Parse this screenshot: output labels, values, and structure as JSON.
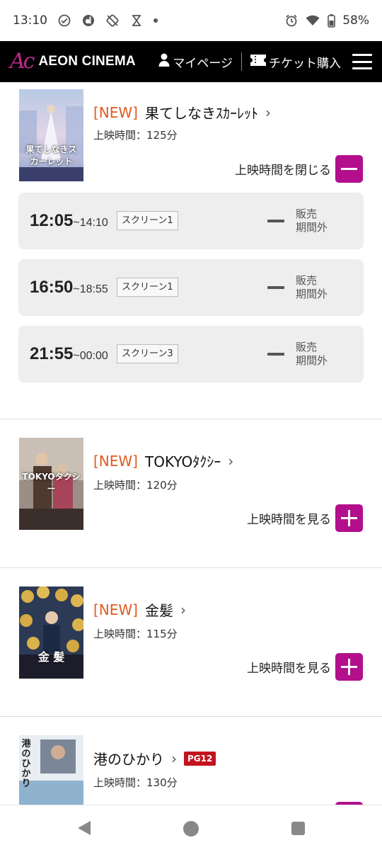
{
  "status_bar": {
    "time": "13:10",
    "left_icons": [
      "check-circle-icon",
      "d-app-icon",
      "rotate-off-icon",
      "hourglass-icon",
      "dot-icon"
    ],
    "right_icons": [
      "alarm-icon",
      "wifi-icon",
      "battery-icon"
    ],
    "battery": "58%"
  },
  "header": {
    "logo_mark": "Ac",
    "brand": "AEON CINEMA",
    "mypage_label": "マイページ",
    "ticket_label": "チケット購入",
    "accent_color": "#b30f8c"
  },
  "movies": [
    {
      "new_label": "[NEW]",
      "title": "果てしなきｽｶｰﾚｯﾄ",
      "duration": "上映時間：125分",
      "toggle_label": "上映時間を閉じる",
      "poster_caption": "果てしなきスカーレット",
      "showtimes": [
        {
          "start": "12:05",
          "end": "~14:10",
          "screen": "スクリーン1",
          "status": "販売\n期間外"
        },
        {
          "start": "16:50",
          "end": "~18:55",
          "screen": "スクリーン1",
          "status": "販売\n期間外"
        },
        {
          "start": "21:55",
          "end": "~00:00",
          "screen": "スクリーン3",
          "status": "販売\n期間外"
        }
      ]
    },
    {
      "new_label": "[NEW]",
      "title": "TOKYOﾀｸｼｰ",
      "duration": "上映時間：120分",
      "toggle_label": "上映時間を見る",
      "poster_caption": "TOKYOタクシー"
    },
    {
      "new_label": "[NEW]",
      "title": "金髪",
      "duration": "上映時間：115分",
      "toggle_label": "上映時間を見る",
      "poster_caption": "金 髪"
    },
    {
      "title": "港のひかり",
      "rating": "PG12",
      "duration": "上映時間：130分",
      "poster_caption": "港のひかり"
    }
  ]
}
